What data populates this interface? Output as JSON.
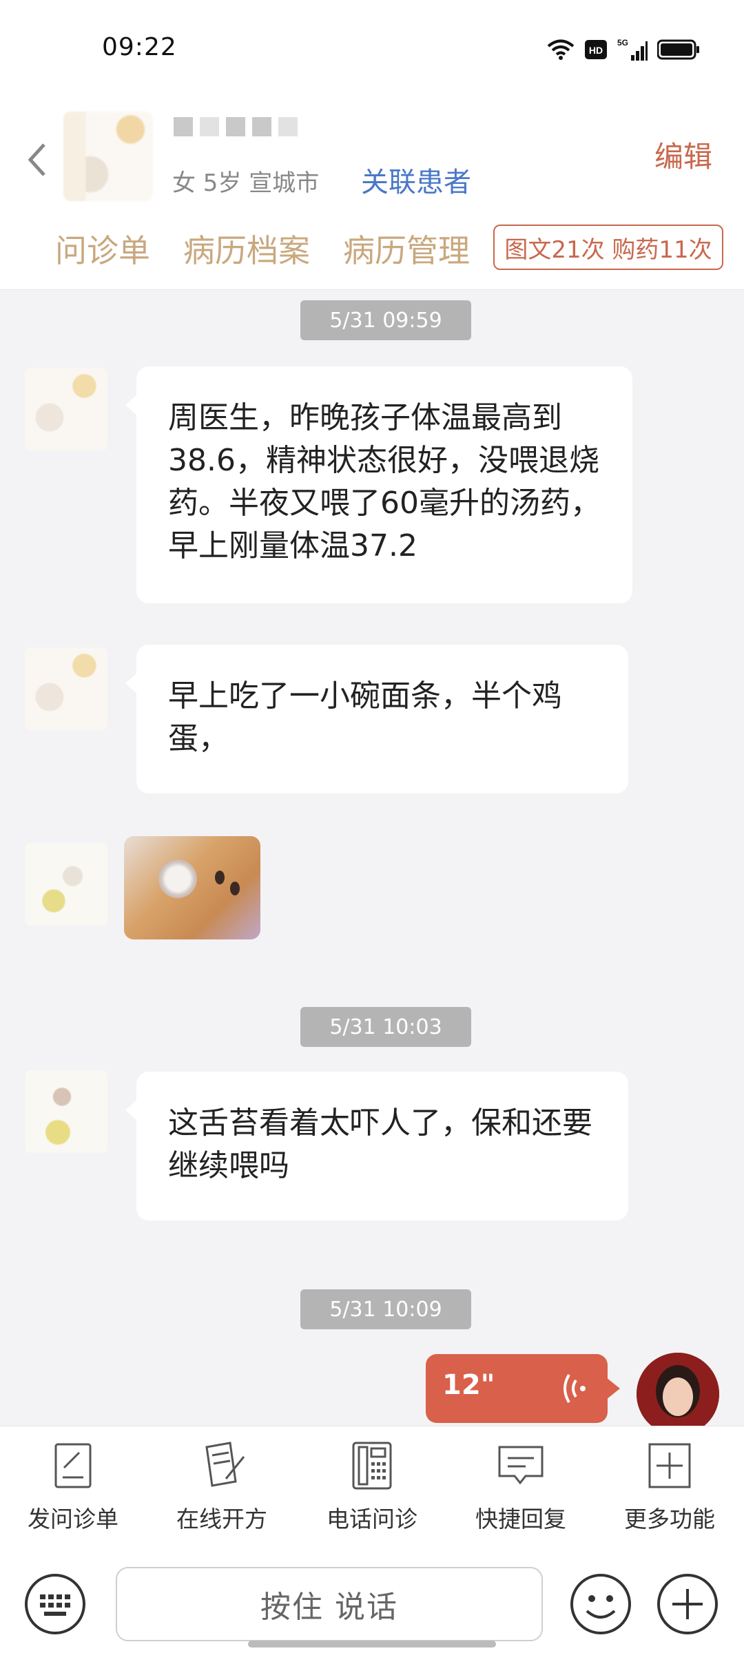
{
  "status_bar": {
    "time": "09:22",
    "network": "5G"
  },
  "header": {
    "patient_info": "女 5岁  宣城市",
    "link_patient": "关联患者",
    "edit": "编辑",
    "tabs": [
      "问诊单",
      "病历档案",
      "病历管理"
    ],
    "count_badge": "图文21次 购药11次"
  },
  "chat": {
    "time1": "5/31 09:59",
    "msg1": "周医生，昨晚孩子体温最高到38.6，精神状态很好，没喂退烧药。半夜又喂了60毫升的汤药，早上刚量体温37.2",
    "msg2": "早上吃了一小碗面条，半个鸡蛋，",
    "time2": "5/31 10:03",
    "msg3": "这舌苔看着太吓人了，保和还要继续喂吗",
    "time3": "5/31 10:09",
    "voice_duration": "12\""
  },
  "toolbar": {
    "items": [
      "发问诊单",
      "在线开方",
      "电话问诊",
      "快捷回复",
      "更多功能"
    ]
  },
  "input": {
    "hold_to_talk": "按住 说话"
  },
  "colors": {
    "accent": "#c8684d",
    "tab": "#c9a87e",
    "link": "#4a78c9",
    "voice": "#d9604b"
  }
}
